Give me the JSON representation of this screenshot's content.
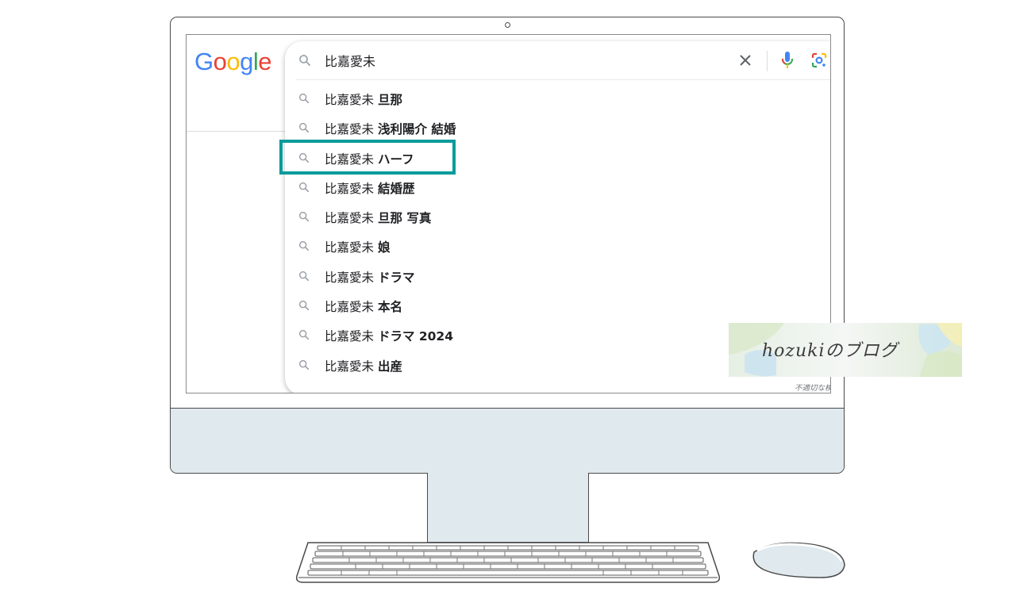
{
  "logo": {
    "letters": [
      "G",
      "o",
      "o",
      "g",
      "l",
      "e"
    ],
    "colors": [
      "#4285F4",
      "#EA4335",
      "#FBBC05",
      "#4285F4",
      "#34A853",
      "#EA4335"
    ]
  },
  "search": {
    "query": "比嘉愛未"
  },
  "icons": {
    "search": "search-icon",
    "clear": "close-icon",
    "voice": "microphone-icon",
    "lens": "google-lens-icon"
  },
  "suggestions": [
    {
      "prefix": "比嘉愛未",
      "bold": "旦那"
    },
    {
      "prefix": "比嘉愛未",
      "bold": "浅利陽介 結婚"
    },
    {
      "prefix": "比嘉愛未",
      "bold": "ハーフ"
    },
    {
      "prefix": "比嘉愛未",
      "bold": "結婚歴"
    },
    {
      "prefix": "比嘉愛未",
      "bold": "旦那 写真"
    },
    {
      "prefix": "比嘉愛未",
      "bold": "娘"
    },
    {
      "prefix": "比嘉愛未",
      "bold": "ドラマ"
    },
    {
      "prefix": "比嘉愛未",
      "bold": "本名"
    },
    {
      "prefix": "比嘉愛未",
      "bold": "ドラマ 2024"
    },
    {
      "prefix": "比嘉愛未",
      "bold": "出産"
    }
  ],
  "report_text": "不適切な検索候補",
  "highlight_color": "#0a9b9b",
  "watermark": {
    "text": "hozukiのブログ"
  }
}
